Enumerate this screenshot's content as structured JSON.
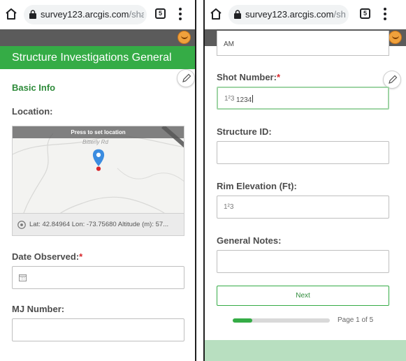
{
  "browser": {
    "url_host": "survey123.arcgis.com",
    "url_path": "/share",
    "tab_count": "5"
  },
  "left": {
    "header_title": "Structure Investigations General",
    "section_title": "Basic Info",
    "location_label": "Location:",
    "map_banner": "Press to set location",
    "map_road": "Bitterly Rd",
    "map_coords": "Lat: 42.84964  Lon: -73.75680  Altitude (m): 57...",
    "date_label": "Date Observed:",
    "required_mark": "*",
    "mj_label": "MJ Number:"
  },
  "right": {
    "prev_field_value": "AM",
    "shot_label": "Shot Number:",
    "required_mark": "*",
    "numeric_prefix": "1²3",
    "shot_value": "1234",
    "structure_label": "Structure ID:",
    "rim_label": "Rim Elevation (Ft):",
    "notes_label": "General Notes:",
    "next_label": "Next",
    "page_indicator": "Page 1 of 5",
    "progress_fraction": 0.2
  },
  "colors": {
    "brand_green": "#35ac46",
    "required_red": "#d8262b",
    "toolbar_gray": "#5b5b5b"
  }
}
